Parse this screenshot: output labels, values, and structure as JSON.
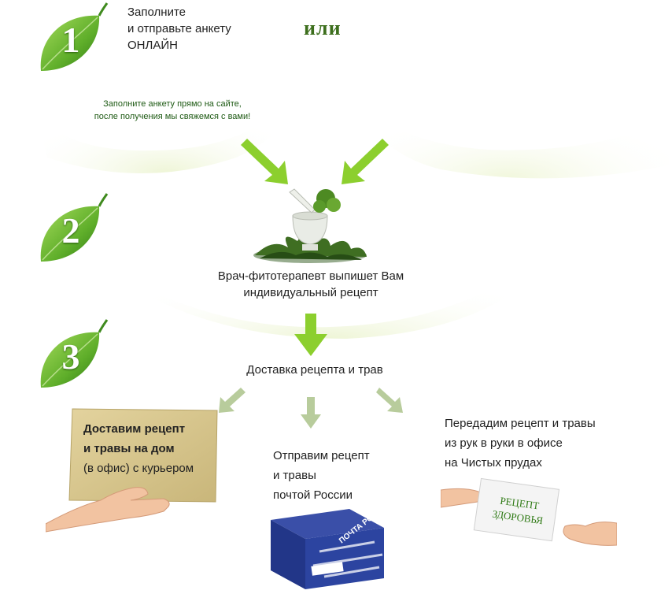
{
  "steps": [
    {
      "number": "1"
    },
    {
      "number": "2"
    },
    {
      "number": "3"
    }
  ],
  "step1": {
    "lines": [
      "Заполните",
      "и отправьте анкету",
      "ОНЛАЙН"
    ],
    "or_word": "или",
    "note_lines": [
      "Заполните анкету прямо на сайте,",
      "после получения мы свяжемся с вами!"
    ]
  },
  "step2": {
    "lines": [
      "Врач-фитотерапевт выпишет Вам",
      "индивидуальный рецепт"
    ]
  },
  "step3": {
    "title": "Доставка рецепта и трав"
  },
  "options": {
    "courier": {
      "bold_lines": [
        "Доставим рецепт",
        "и травы на дом"
      ],
      "note": "(в офис) с курьером"
    },
    "post": {
      "lines": [
        "Отправим рецепт",
        "и травы",
        "почтой России"
      ],
      "box_logo_text": "ПОЧТА РОССИИ"
    },
    "office": {
      "lines": [
        "Передадим рецепт и травы",
        "из рук в руки в офисе",
        "на Чистых прудах"
      ],
      "card_lines": [
        "РЕЦЕПТ",
        "ЗДОРОВЬЯ"
      ]
    }
  },
  "colors": {
    "leaf_dark": "#3f8a1e",
    "leaf_light": "#8fd14f",
    "arrow_green": "#8ccf2e",
    "arrow_pale": "#b8cc9c",
    "accent_text": "#3c6e1c"
  }
}
